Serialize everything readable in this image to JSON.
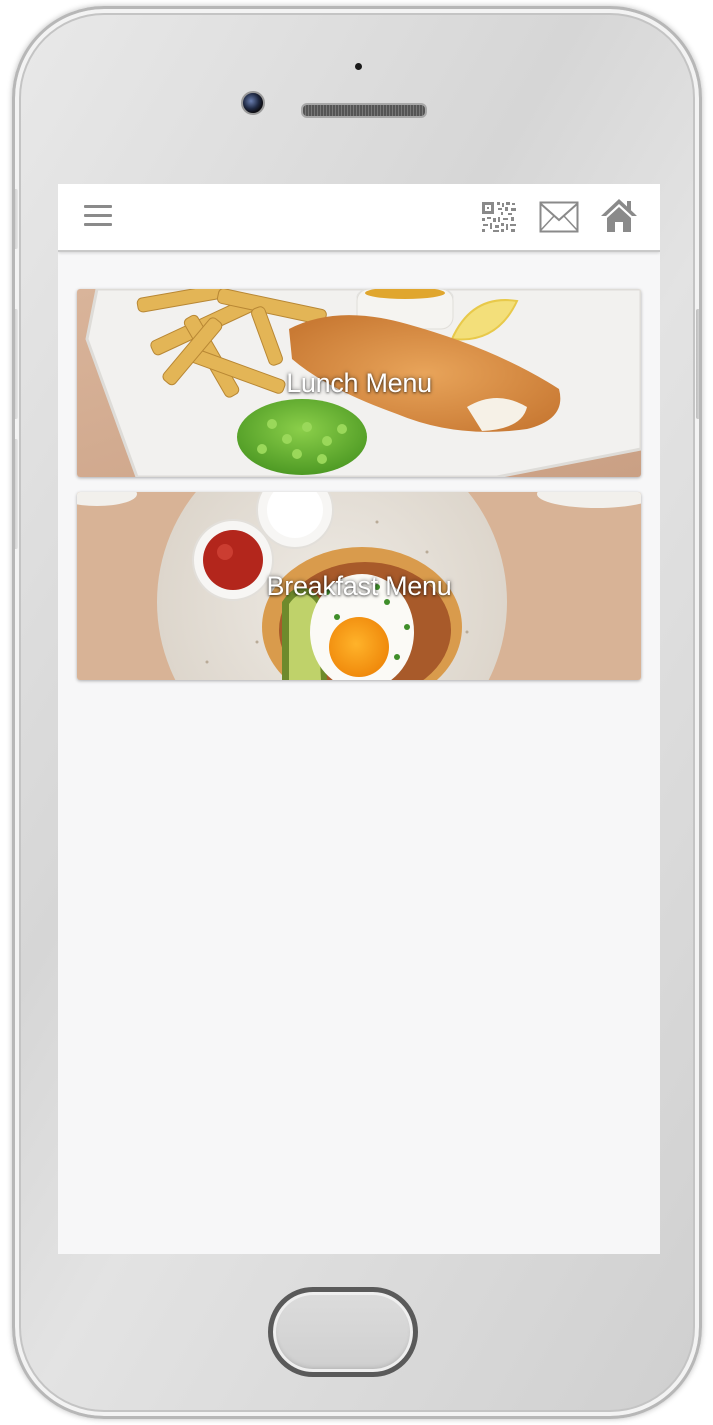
{
  "header": {
    "menu_icon": "hamburger-icon",
    "qr_icon": "qr-code-icon",
    "mail_icon": "envelope-icon",
    "home_icon": "home-icon"
  },
  "menus": [
    {
      "label": "Lunch Menu",
      "image": "fish-and-chips-photo"
    },
    {
      "label": "Breakfast Menu",
      "image": "egg-and-avocado-photo"
    }
  ],
  "colors": {
    "header_bg": "#ffffff",
    "screen_bg": "#f7f7f8",
    "icon_gray": "#8a8a8a",
    "label_text": "#ffffff"
  }
}
